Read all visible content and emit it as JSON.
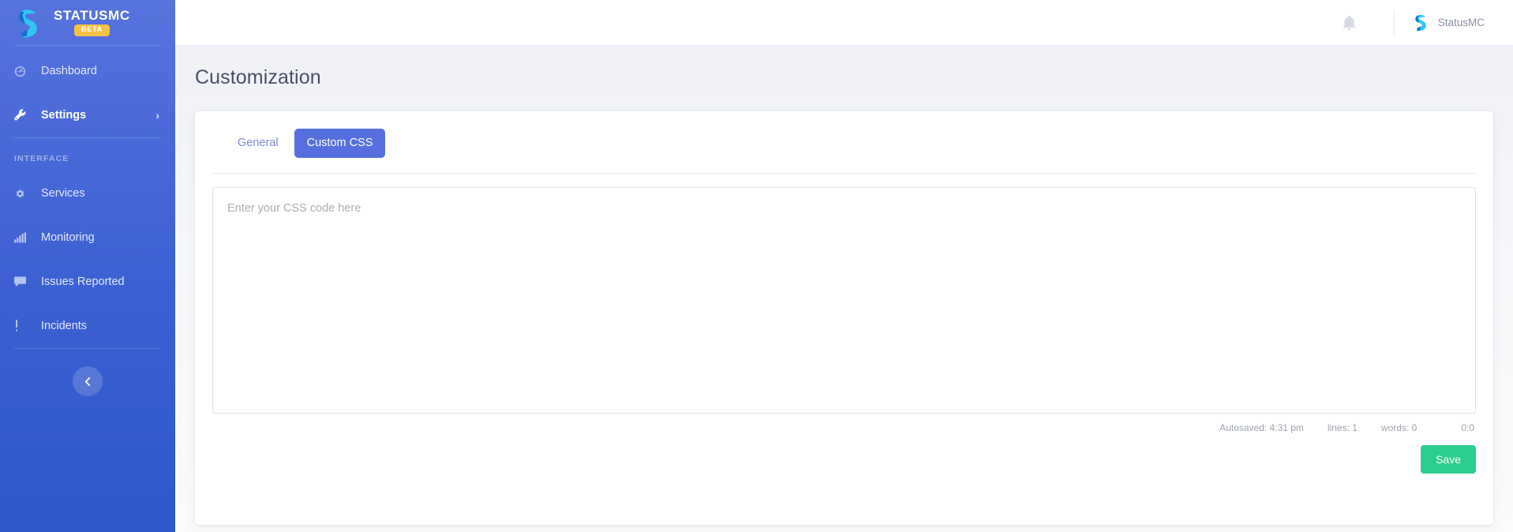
{
  "sidebar": {
    "brand": {
      "name": "STATUSMC",
      "badge": "BETA",
      "logo_icon": "statusmc-s-logo-icon"
    },
    "items": [
      {
        "label": "Dashboard",
        "icon": "speedometer-icon",
        "active": false,
        "chevron": ""
      },
      {
        "label": "Settings",
        "icon": "wrench-icon",
        "active": true,
        "chevron": "›"
      }
    ],
    "section_label": "INTERFACE",
    "interface_items": [
      {
        "label": "Services",
        "icon": "gear-icon"
      },
      {
        "label": "Monitoring",
        "icon": "bar-chart-icon"
      },
      {
        "label": "Issues Reported",
        "icon": "comment-icon"
      },
      {
        "label": "Incidents",
        "icon": "exclamation-icon"
      }
    ],
    "collapse_icon": "chevron-left-icon"
  },
  "topbar": {
    "notifications_icon": "bell-icon",
    "user_logo_icon": "statusmc-s-logo-icon",
    "user_name": "StatusMC"
  },
  "page": {
    "title": "Customization"
  },
  "tabs": [
    {
      "label": "General",
      "active": false
    },
    {
      "label": "Custom CSS",
      "active": true
    }
  ],
  "editor": {
    "placeholder": "Enter your CSS code here",
    "value": ""
  },
  "status": {
    "autosaved": "Autosaved: 4:31 pm",
    "lines": "lines: 1",
    "words": "words: 0",
    "cursor": "0:0"
  },
  "actions": {
    "save_label": "Save"
  },
  "colors": {
    "sidebar_top": "#5673DD",
    "sidebar_bottom": "#2E57C7",
    "accent_blue": "#5570DE",
    "badge_yellow": "#F6C244",
    "save_green": "#2BCE8D",
    "logo_cyan": "#2FC6F0"
  }
}
